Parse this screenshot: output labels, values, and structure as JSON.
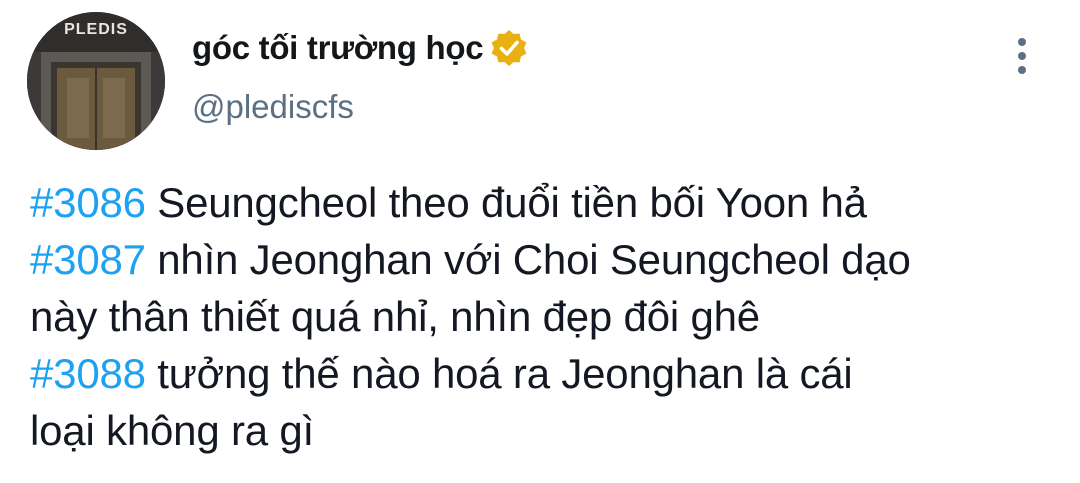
{
  "author": {
    "display_name": "góc tối trường học",
    "handle": "@plediscfs",
    "verified": true,
    "avatar_text": "PLEDIS"
  },
  "tweet": {
    "lines": [
      {
        "hashtag": "#3086",
        "text": " Seungcheol theo đuổi tiền bối Yoon hả"
      },
      {
        "hashtag": "#3087",
        "text": " nhìn Jeonghan với Choi Seungcheol dạo"
      },
      {
        "hashtag": "",
        "text": "này thân thiết quá nhỉ, nhìn đẹp đôi ghê"
      },
      {
        "hashtag": "#3088",
        "text": " tưởng thế nào hoá ra Jeonghan là cái"
      },
      {
        "hashtag": "",
        "text": "loại không ra gì"
      }
    ]
  },
  "icons": {
    "verified_badge": "verified-badge-icon",
    "more": "more-options-icon"
  },
  "colors": {
    "hashtag": "#1da1f2",
    "handle": "#5b7083",
    "verified": "#e8b012"
  }
}
